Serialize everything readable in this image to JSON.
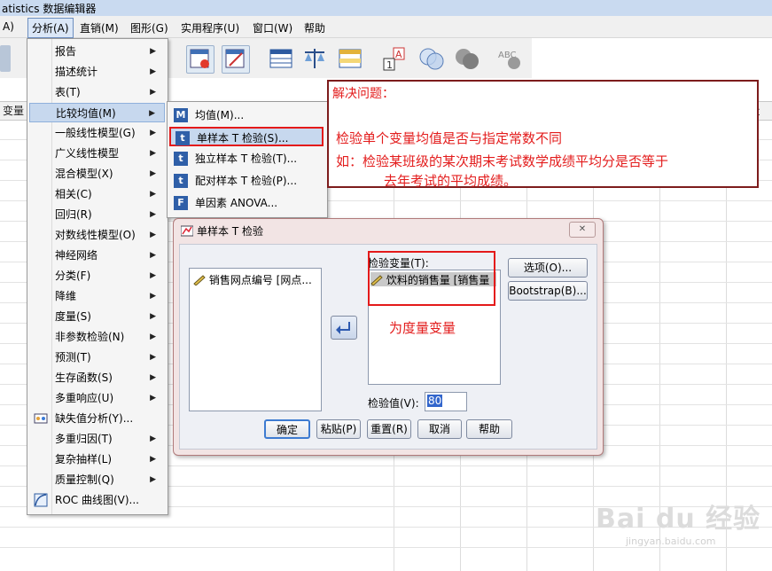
{
  "window": {
    "title": "atistics 数据编辑器"
  },
  "menubar": {
    "items": [
      "A)",
      "分析(A)",
      "直销(M)",
      "图形(G)",
      "实用程序(U)",
      "窗口(W)",
      "帮助"
    ]
  },
  "analyze_menu": {
    "items": [
      {
        "label": "报告",
        "submenu": true
      },
      {
        "label": "描述统计",
        "submenu": true
      },
      {
        "label": "表(T)",
        "submenu": true
      },
      {
        "label": "比较均值(M)",
        "submenu": true,
        "highlighted": true
      },
      {
        "label": "一般线性模型(G)",
        "submenu": true
      },
      {
        "label": "广义线性模型",
        "submenu": true
      },
      {
        "label": "混合模型(X)",
        "submenu": true
      },
      {
        "label": "相关(C)",
        "submenu": true
      },
      {
        "label": "回归(R)",
        "submenu": true
      },
      {
        "label": "对数线性模型(O)",
        "submenu": true
      },
      {
        "label": "神经网络",
        "submenu": true
      },
      {
        "label": "分类(F)",
        "submenu": true
      },
      {
        "label": "降维",
        "submenu": true
      },
      {
        "label": "度量(S)",
        "submenu": true
      },
      {
        "label": "非参数检验(N)",
        "submenu": true
      },
      {
        "label": "预测(T)",
        "submenu": true
      },
      {
        "label": "生存函数(S)",
        "submenu": true
      },
      {
        "label": "多重响应(U)",
        "submenu": true
      },
      {
        "label": "缺失值分析(Y)...",
        "submenu": false
      },
      {
        "label": "多重归因(T)",
        "submenu": true
      },
      {
        "label": "复杂抽样(L)",
        "submenu": true
      },
      {
        "label": "质量控制(Q)",
        "submenu": true
      },
      {
        "label": "ROC 曲线图(V)...",
        "submenu": false
      }
    ]
  },
  "compare_means_menu": {
    "items": [
      {
        "label": "均值(M)...",
        "icon": "M"
      },
      {
        "label": "单样本 T 检验(S)...",
        "icon": "t",
        "highlighted": true
      },
      {
        "label": "独立样本 T 检验(T)...",
        "icon": "t"
      },
      {
        "label": "配对样本 T 检验(P)...",
        "icon": "t"
      },
      {
        "label": "单因素 ANOVA...",
        "icon": "F"
      }
    ]
  },
  "grid": {
    "column_header": "变量"
  },
  "annotation": {
    "heading": "解决问题：",
    "line1": "检验单个变量均值是否与指定常数不同",
    "line2": "如：检验某班级的某次期末考试数学成绩平均分是否等于",
    "line3": "去年考试的平均成绩。",
    "note": "为度量变量"
  },
  "dialog": {
    "title": "单样本 T 检验",
    "close_glyph": "✕",
    "source_list": [
      "销售网点编号 [网点..."
    ],
    "test_var_label": "检验变量(T):",
    "test_vars": [
      "饮料的销售量 [销售量"
    ],
    "test_value_label": "检验值(V):",
    "test_value": "80",
    "buttons": {
      "options": "选项(O)...",
      "bootstrap": "Bootstrap(B)...",
      "ok": "确定",
      "paste": "粘贴(P)",
      "reset": "重置(R)",
      "cancel": "取消",
      "help": "帮助"
    }
  },
  "watermark": {
    "text": "Bai du 经验",
    "url": "jingyan.baidu.com"
  }
}
